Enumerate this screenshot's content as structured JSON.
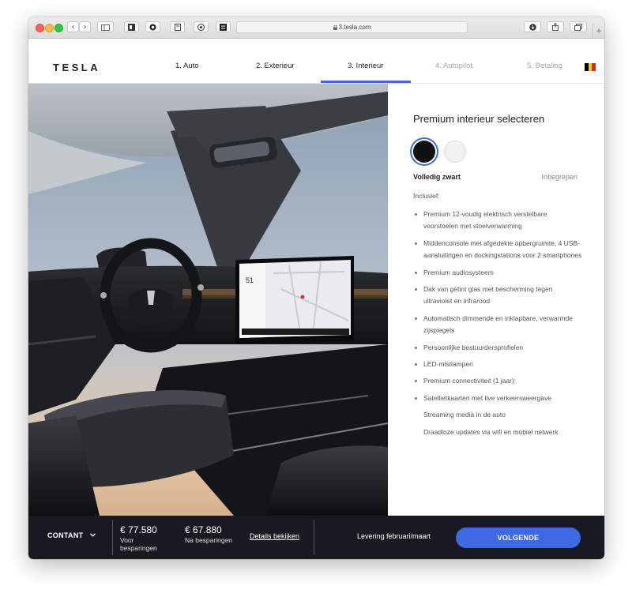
{
  "browser": {
    "url": "3.tesla.com",
    "controls": {
      "back": "‹",
      "forward": "›",
      "new_tab": "+"
    }
  },
  "site": {
    "logo": "TESLA",
    "steps": [
      {
        "label": "1. Auto",
        "state": "done"
      },
      {
        "label": "2. Exterieur",
        "state": "done"
      },
      {
        "label": "3. Interieur",
        "state": "active"
      },
      {
        "label": "4. Autopilot",
        "state": "disabled"
      },
      {
        "label": "5. Betaling",
        "state": "disabled"
      }
    ],
    "flag_colors": [
      "#000000",
      "#f5d000",
      "#e1261c"
    ]
  },
  "panel": {
    "title": "Premium interieur selecteren",
    "swatches": [
      {
        "name": "black",
        "color": "#111111",
        "selected": true
      },
      {
        "name": "white",
        "color": "#f2f2f2",
        "selected": false
      }
    ],
    "selected_name": "Volledig zwart",
    "selected_price": "Inbegrepen",
    "included_label": "Inclusief:",
    "features": [
      "Premium 12-voudig elektrisch verstelbare voorstoelen met stoelverwarming",
      "Middenconsole met afgedekte opbergruimte, 4 USB-aansluitingen en dockingstations voor 2 smartphones",
      "Premium audiosysteem",
      "Dak van getint glas met bescherming tegen ultraviolet en infrarood",
      "Automatisch dimmende en inklapbare, verwarmde zijspiegels",
      "Persoonlijke bestuurdersprofielen",
      "LED-mistlampen",
      "Premium connectiviteit (1 jaar):",
      "Satellietkaarten met live verkeersweergave",
      "Streaming media in de auto",
      "Draadloze updates via wifi en mobiel netwerk"
    ]
  },
  "footer": {
    "payment_method": "CONTANT",
    "price_before": "€ 77.580",
    "price_before_label": "Voor besparingen",
    "price_after": "€ 67.880",
    "price_after_label": "Na besparingen",
    "details_link": "Details bekijken",
    "delivery": "Levering februari/maart",
    "next_button": "VOLGENDE",
    "accent_color": "#3e6ae1"
  },
  "screen": {
    "speed": "51"
  }
}
